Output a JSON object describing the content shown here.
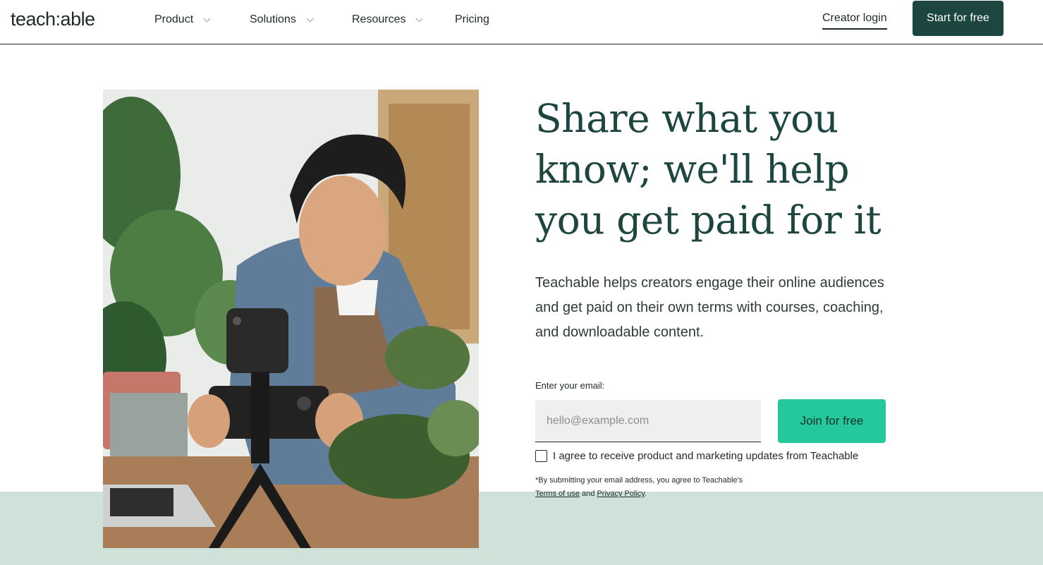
{
  "header": {
    "logo": "teach:able",
    "nav": [
      {
        "label": "Product",
        "has_dropdown": true
      },
      {
        "label": "Solutions",
        "has_dropdown": true
      },
      {
        "label": "Resources",
        "has_dropdown": true
      },
      {
        "label": "Pricing",
        "has_dropdown": false
      }
    ],
    "creator_login": "Creator login",
    "start_button": "Start for free"
  },
  "hero": {
    "headline": "Share what you know; we'll help you get paid for it",
    "subtext": "Teachable helps creators engage their online audiences and get paid on their own terms with courses, coaching, and downloadable content.",
    "email_label": "Enter your email:",
    "email_placeholder": "hello@example.com",
    "email_value": "",
    "join_button": "Join for free",
    "consent_label": "I agree to receive product and marketing updates from Teachable",
    "consent_checked": false,
    "fineprint_prefix": "*By submitting your email address, you agree to Teachable's ",
    "terms_link": "Terms of use",
    "fineprint_and": " and ",
    "privacy_link": "Privacy Policy",
    "fineprint_suffix": "."
  },
  "colors": {
    "brand_dark": "#1e4640",
    "accent_green": "#25c79d",
    "band_mint": "#cfe2da"
  },
  "icons": {
    "nav_dropdown": "chevron-down-icon"
  }
}
